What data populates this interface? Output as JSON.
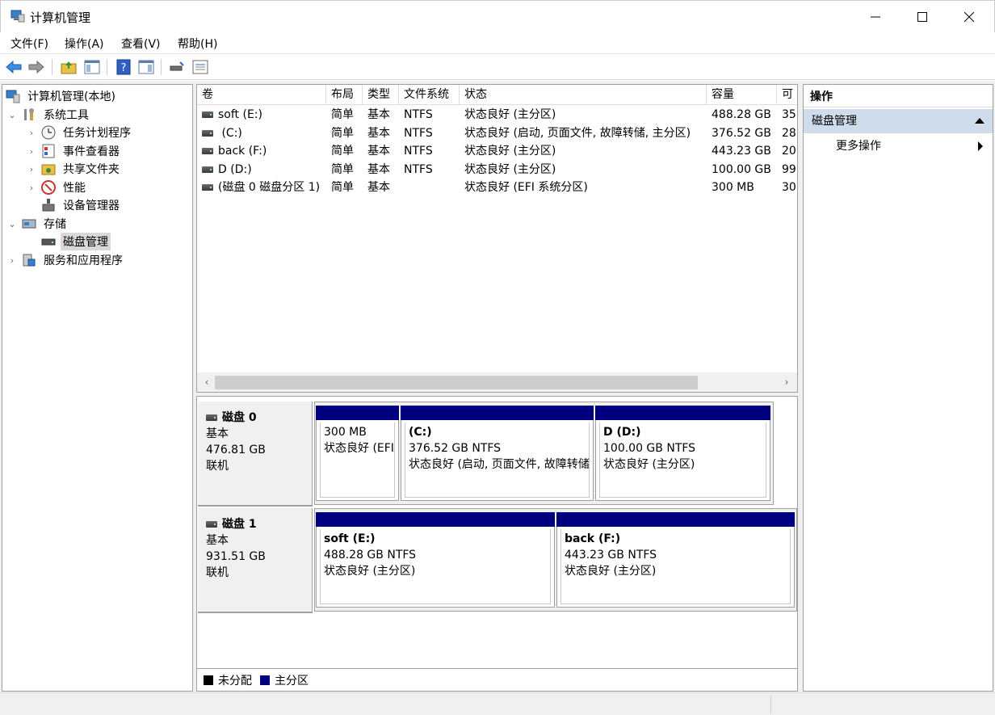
{
  "window": {
    "title": "计算机管理"
  },
  "menu": [
    "文件(F)",
    "操作(A)",
    "查看(V)",
    "帮助(H)"
  ],
  "tree": {
    "root": "计算机管理(本地)",
    "system_tools": "系统工具",
    "task_scheduler": "任务计划程序",
    "event_viewer": "事件查看器",
    "shared_folders": "共享文件夹",
    "performance": "性能",
    "device_manager": "设备管理器",
    "storage": "存储",
    "disk_management": "磁盘管理",
    "services_apps": "服务和应用程序"
  },
  "volumes": {
    "columns": [
      "卷",
      "布局",
      "类型",
      "文件系统",
      "状态",
      "容量",
      "可"
    ],
    "rows": [
      [
        "soft (E:)",
        "简单",
        "基本",
        "NTFS",
        "状态良好 (主分区)",
        "488.28 GB",
        "35"
      ],
      [
        " (C:)",
        "简单",
        "基本",
        "NTFS",
        "状态良好 (启动, 页面文件, 故障转储, 主分区)",
        "376.52 GB",
        "28"
      ],
      [
        "back (F:)",
        "简单",
        "基本",
        "NTFS",
        "状态良好 (主分区)",
        "443.23 GB",
        "20"
      ],
      [
        "D (D:)",
        "简单",
        "基本",
        "NTFS",
        "状态良好 (主分区)",
        "100.00 GB",
        "99"
      ],
      [
        "(磁盘 0 磁盘分区 1)",
        "简单",
        "基本",
        "",
        "状态良好 (EFI 系统分区)",
        "300 MB",
        "30"
      ]
    ]
  },
  "disks": [
    {
      "name": "磁盘 0",
      "type": "基本",
      "size": "476.81 GB",
      "status": "联机",
      "partitions": [
        {
          "name": "",
          "size": "300 MB",
          "status": "状态良好 (EFI"
        },
        {
          "name": "  (C:)",
          "size": "376.52 GB NTFS",
          "status": "状态良好 (启动, 页面文件, 故障转储"
        },
        {
          "name": "D  (D:)",
          "size": "100.00 GB NTFS",
          "status": "状态良好 (主分区)"
        }
      ]
    },
    {
      "name": "磁盘 1",
      "type": "基本",
      "size": "931.51 GB",
      "status": "联机",
      "partitions": [
        {
          "name": "soft  (E:)",
          "size": "488.28 GB NTFS",
          "status": "状态良好 (主分区)"
        },
        {
          "name": "back  (F:)",
          "size": "443.23 GB NTFS",
          "status": "状态良好 (主分区)"
        }
      ]
    }
  ],
  "legend": {
    "unallocated": "未分配",
    "primary": "主分区",
    "unallocated_color": "#000000",
    "primary_color": "#00007f"
  },
  "actions": {
    "header": "操作",
    "section": "磁盘管理",
    "more": "更多操作"
  },
  "colors": {
    "partition_bar": "#00007f",
    "action_section_bg": "#cfdceb"
  }
}
